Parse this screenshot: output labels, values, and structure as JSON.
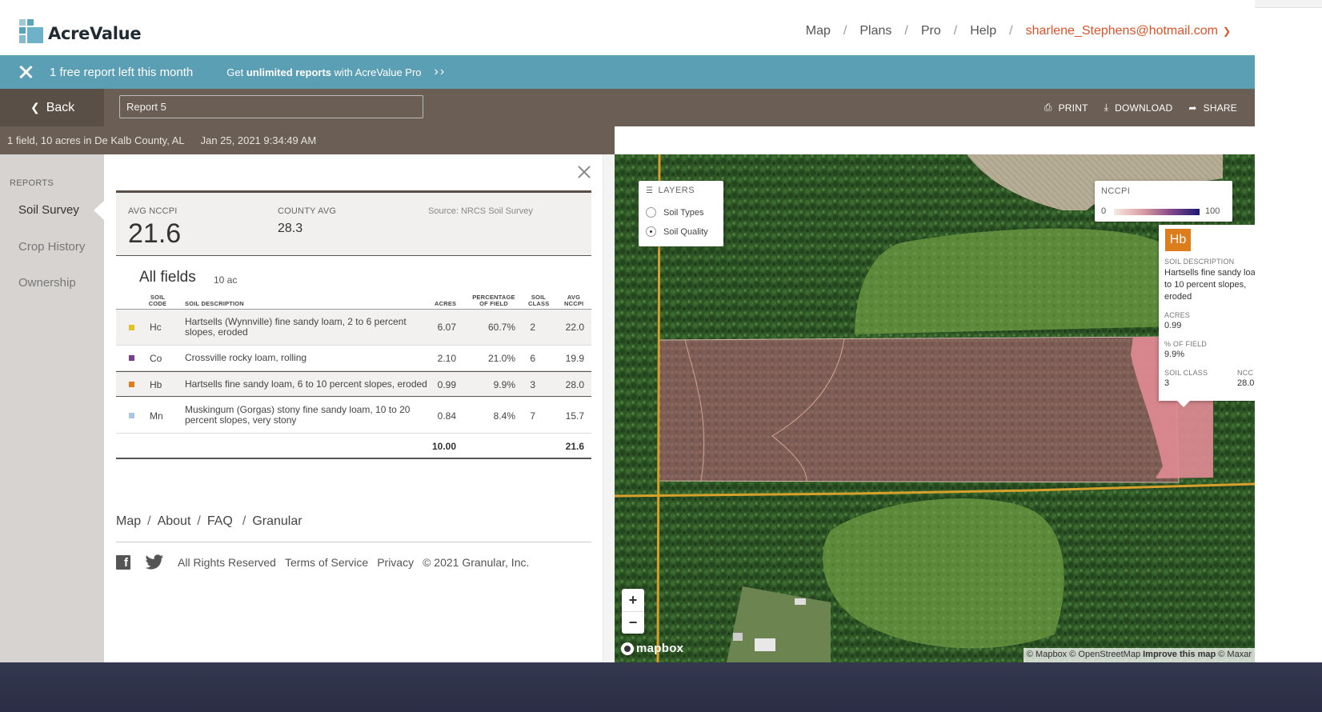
{
  "app": {
    "name": "AcreValue"
  },
  "nav": {
    "items": [
      "Map",
      "Plans",
      "Pro",
      "Help"
    ],
    "user": "sharlene_Stephens@hotmail.com"
  },
  "promo": {
    "left": "1 free report left this month",
    "get": "Get",
    "bold": "unlimited reports",
    "rest": "with AcreValue Pro"
  },
  "toolbar": {
    "back": "Back",
    "report_name": "Report 5",
    "print": "PRINT",
    "download": "DOWNLOAD",
    "share": "SHARE"
  },
  "info": {
    "summary": "1 field, 10 acres in De Kalb County, AL",
    "date": "Jan 25, 2021 9:34:49 AM"
  },
  "sidenav": {
    "heading": "REPORTS",
    "items": [
      "Soil Survey",
      "Crop History",
      "Ownership"
    ]
  },
  "report": {
    "avg_label": "AVG NCCPI",
    "avg_value": "21.6",
    "county_label": "COUNTY AVG",
    "county_value": "28.3",
    "source": "Source: NRCS Soil Survey",
    "fields_title": "All fields",
    "fields_acres": "10 ac",
    "columns": {
      "code": "SOIL CODE",
      "desc": "SOIL DESCRIPTION",
      "acres": "ACRES",
      "pct": "PERCENTAGE OF FIELD",
      "class": "SOIL CLASS",
      "nccpi": "AVG NCCPI"
    },
    "rows": [
      {
        "code": "Hc",
        "desc": "Hartsells (Wynnville) fine sandy loam, 2 to 6 percent slopes, eroded",
        "acres": "6.07",
        "pct": "60.7%",
        "class": "2",
        "nccpi": "22.0",
        "color": "#e3c125"
      },
      {
        "code": "Co",
        "desc": "Crossville rocky loam, rolling",
        "acres": "2.10",
        "pct": "21.0%",
        "class": "6",
        "nccpi": "19.9",
        "color": "#7a3f8c"
      },
      {
        "code": "Hb",
        "desc": "Hartsells fine sandy loam, 6 to 10 percent slopes, eroded",
        "acres": "0.99",
        "pct": "9.9%",
        "class": "3",
        "nccpi": "28.0",
        "color": "#dc7d1e"
      },
      {
        "code": "Mn",
        "desc": "Muskingum (Gorgas) stony fine sandy loam, 10 to 20 percent slopes, very stony",
        "acres": "0.84",
        "pct": "8.4%",
        "class": "7",
        "nccpi": "15.7",
        "color": "#a9c6e6"
      }
    ],
    "total_acres": "10.00",
    "total_nccpi": "21.6"
  },
  "footer": {
    "links": [
      "Map",
      "About",
      "FAQ",
      "Granular"
    ],
    "rights": "All Rights Reserved",
    "terms": "Terms of Service",
    "privacy": "Privacy",
    "copyright": "© 2021 Granular, Inc."
  },
  "map": {
    "layers_title": "LAYERS",
    "layer_options": [
      "Soil Types",
      "Soil Quality"
    ],
    "selected_layer": "Soil Quality",
    "legend_title": "NCCPI",
    "legend_min": "0",
    "legend_max": "100",
    "popup": {
      "code": "Hb",
      "desc_label": "SOIL DESCRIPTION",
      "desc_lines": [
        "Hartsells fine sandy loa",
        "to 10 percent slopes,",
        "eroded"
      ],
      "acres_label": "ACRES",
      "acres": "0.99",
      "pct_label": "% OF FIELD",
      "pct": "9.9%",
      "class_label": "SOIL CLASS",
      "class": "3",
      "nccpi_label": "NCC",
      "nccpi": "28.0"
    },
    "zoom_in": "+",
    "zoom_out": "−",
    "brand": "mapbox",
    "attribution": "© Mapbox © OpenStreetMap",
    "improve": "Improve this map",
    "maxar": "© Maxar"
  }
}
